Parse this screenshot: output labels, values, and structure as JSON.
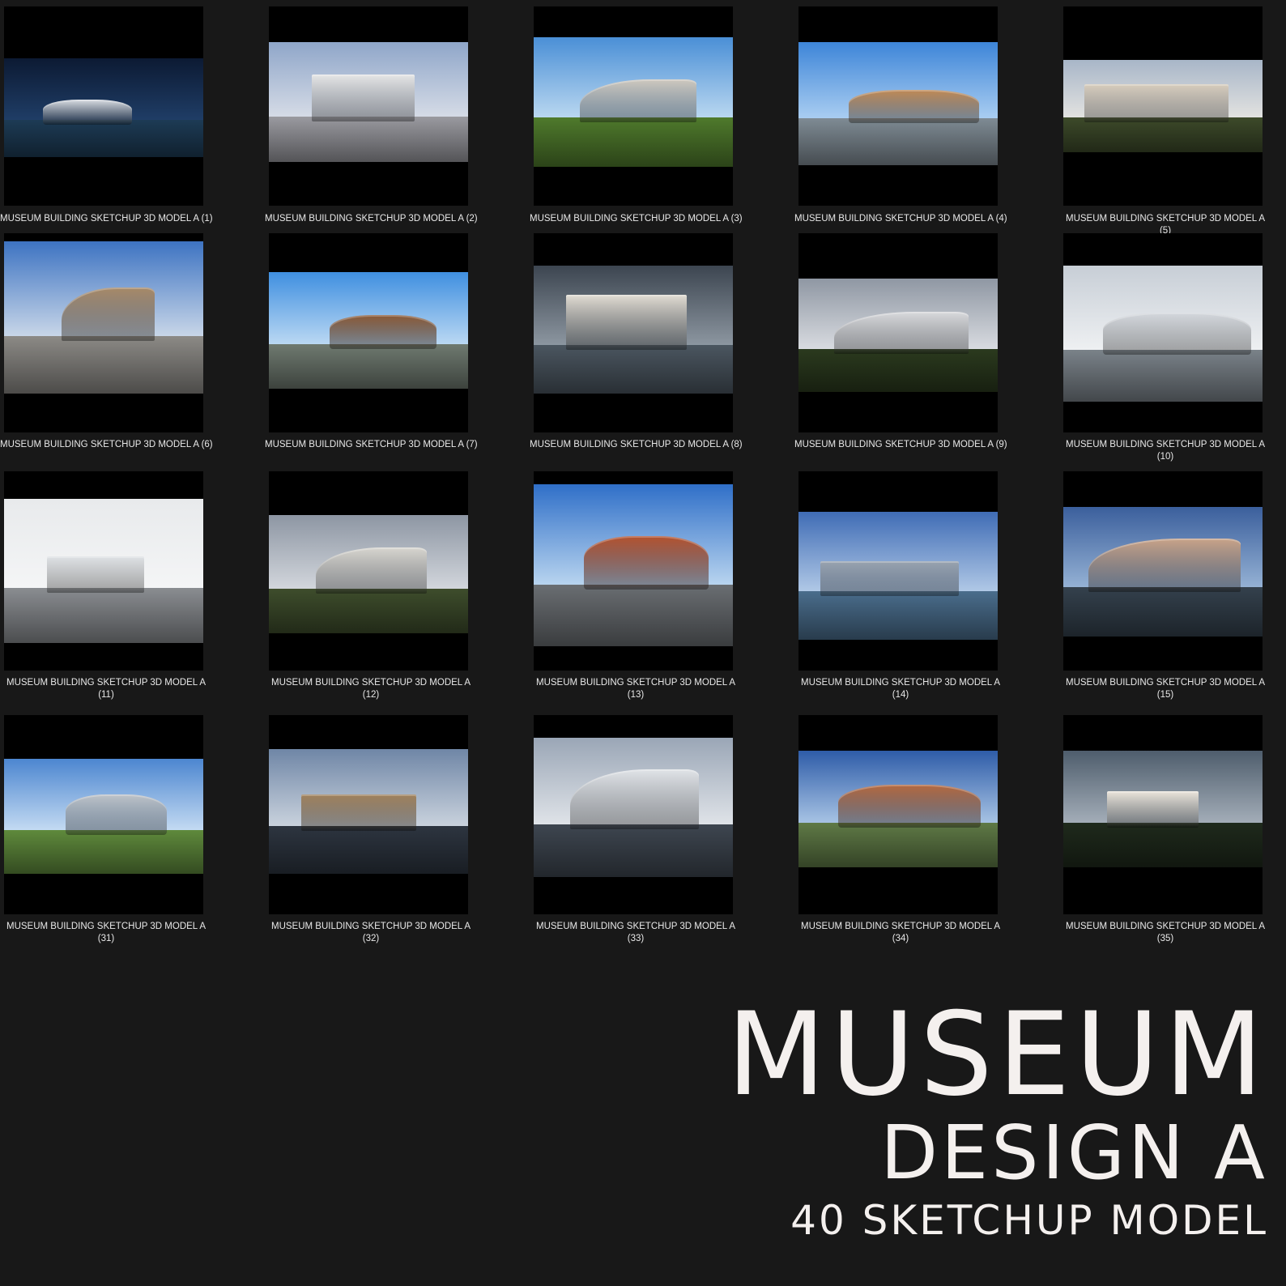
{
  "items": [
    {
      "caption": "MUSEUM BUILDING SKETCHUP 3D MODEL A (1)",
      "sky": [
        "#0c1a33",
        "#1f3d66"
      ],
      "ground": "#1d3b55",
      "bldg": "#d9dde3"
    },
    {
      "caption": "MUSEUM BUILDING SKETCHUP 3D MODEL A (2)",
      "sky": [
        "#8fa6c9",
        "#d5dbe6"
      ],
      "ground": "#9a9aa0",
      "bldg": "#e6e6e6"
    },
    {
      "caption": "MUSEUM BUILDING SKETCHUP 3D MODEL A (3)",
      "sky": [
        "#4a8fd6",
        "#b9d7f0"
      ],
      "ground": "#4f7a2c",
      "bldg": "#cfc9bf"
    },
    {
      "caption": "MUSEUM BUILDING SKETCHUP 3D MODEL A (4)",
      "sky": [
        "#3d85d8",
        "#a9cdf1"
      ],
      "ground": "#7f8b94",
      "bldg": "#c08a55"
    },
    {
      "caption": "MUSEUM BUILDING SKETCHUP 3D MODEL A (5)",
      "sky": [
        "#a8b6c8",
        "#e2e2e0"
      ],
      "ground": "#3d4a2a",
      "bldg": "#d8cdbd"
    },
    {
      "caption": "MUSEUM BUILDING SKETCHUP 3D MODEL A (6)",
      "sky": [
        "#3d73c2",
        "#c8d6e8"
      ],
      "ground": "#8c8a86",
      "bldg": "#a88a68"
    },
    {
      "caption": "MUSEUM BUILDING SKETCHUP 3D MODEL A (7)",
      "sky": [
        "#3f8fe0",
        "#bad8f3"
      ],
      "ground": "#6f7a70",
      "bldg": "#8c5a36"
    },
    {
      "caption": "MUSEUM BUILDING SKETCHUP 3D MODEL A (8)",
      "sky": [
        "#3c4550",
        "#8c96a0"
      ],
      "ground": "#4b5660",
      "bldg": "#e2ddd4"
    },
    {
      "caption": "MUSEUM BUILDING SKETCHUP 3D MODEL A (9)",
      "sky": [
        "#8f97a3",
        "#d8dbe0"
      ],
      "ground": "#2b3a1e",
      "bldg": "#d9dadd"
    },
    {
      "caption": "MUSEUM BUILDING SKETCHUP 3D MODEL A (10)",
      "sky": [
        "#c7ced6",
        "#eef0f2"
      ],
      "ground": "#7a8289",
      "bldg": "#d4d8dd"
    },
    {
      "caption": "MUSEUM BUILDING SKETCHUP 3D MODEL A (11)",
      "sky": [
        "#e8eaec",
        "#f4f5f6"
      ],
      "ground": "#8a8d91",
      "bldg": "#dfe2e5"
    },
    {
      "caption": "MUSEUM BUILDING SKETCHUP 3D MODEL A (12)",
      "sky": [
        "#8d96a3",
        "#d2d6dc"
      ],
      "ground": "#3e4d2c",
      "bldg": "#d8d6d0"
    },
    {
      "caption": "MUSEUM BUILDING SKETCHUP 3D MODEL A (13)",
      "sky": [
        "#2f6fc8",
        "#b8d4ef"
      ],
      "ground": "#6a6e72",
      "bldg": "#b4532f"
    },
    {
      "caption": "MUSEUM BUILDING SKETCHUP 3D MODEL A (14)",
      "sky": [
        "#3f6cb5",
        "#b0c8e6"
      ],
      "ground": "#4a6d8c",
      "bldg": "#9aa4b0"
    },
    {
      "caption": "MUSEUM BUILDING SKETCHUP 3D MODEL A (15)",
      "sky": [
        "#3b5f9c",
        "#94b1d4"
      ],
      "ground": "#34414d",
      "bldg": "#c9a489"
    },
    {
      "caption": "MUSEUM BUILDING SKETCHUP 3D MODEL A (31)",
      "sky": [
        "#4c86d0",
        "#c3daf2"
      ],
      "ground": "#5f8a3c",
      "bldg": "#bfc4c9"
    },
    {
      "caption": "MUSEUM BUILDING SKETCHUP 3D MODEL A (32)",
      "sky": [
        "#6f86a6",
        "#c9d2dd"
      ],
      "ground": "#2d3540",
      "bldg": "#a0815c"
    },
    {
      "caption": "MUSEUM BUILDING SKETCHUP 3D MODEL A (33)",
      "sky": [
        "#9aa6b6",
        "#dfe3e8"
      ],
      "ground": "#3e4650",
      "bldg": "#e1e4e8"
    },
    {
      "caption": "MUSEUM BUILDING SKETCHUP 3D MODEL A (34)",
      "sky": [
        "#2e5ca8",
        "#a7c3e4"
      ],
      "ground": "#5f7a46",
      "bldg": "#b56a40"
    },
    {
      "caption": "MUSEUM BUILDING SKETCHUP 3D MODEL A (35)",
      "sky": [
        "#4e5d6c",
        "#a3adb8"
      ],
      "ground": "#1f2a1c",
      "bldg": "#ece6dc"
    }
  ],
  "title": {
    "line1": "MUSEUM",
    "line2": "DESIGN A",
    "line3": "40 SKETCHUP MODEL"
  },
  "colors": {
    "background": "#181818",
    "frame": "#000000",
    "caption_text": "#e8e8e8",
    "title_text": "#f4f0ee"
  }
}
